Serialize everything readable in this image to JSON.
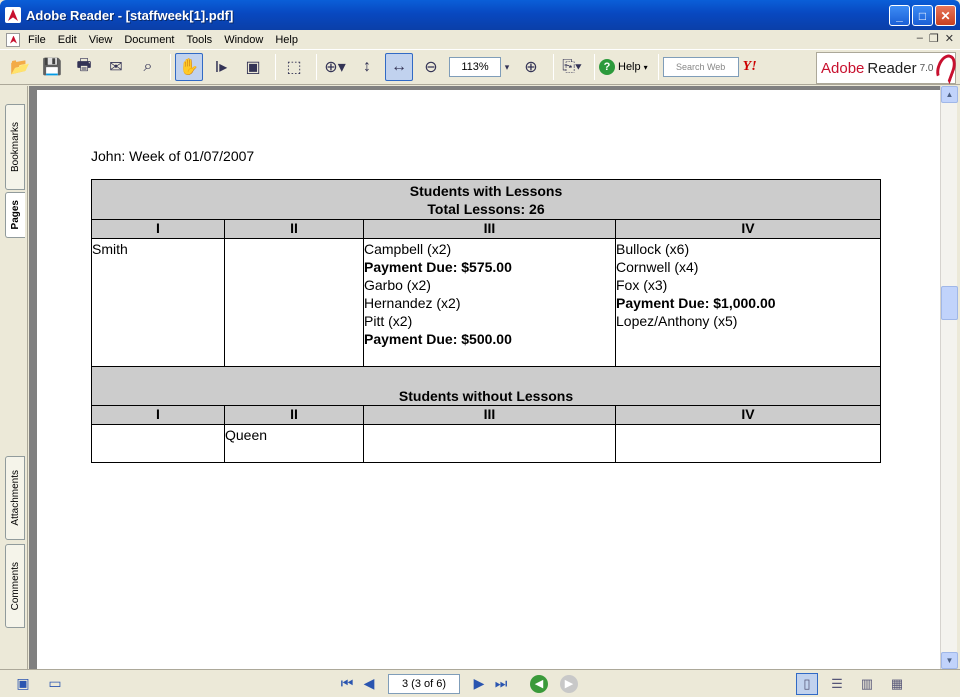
{
  "window": {
    "title": "Adobe Reader - [staffweek[1].pdf]",
    "min_icon": "_",
    "max_icon": "□",
    "close_icon": "✕"
  },
  "menu": {
    "items": [
      "File",
      "Edit",
      "View",
      "Document",
      "Tools",
      "Window",
      "Help"
    ],
    "mdi_min": "–",
    "mdi_restore": "❐",
    "mdi_close": "✕"
  },
  "toolbar": {
    "zoom_value": "113%",
    "help_label": "Help",
    "search_placeholder": "Search Web",
    "yahoo_label": "Y!",
    "brand_adobe": "Adobe",
    "brand_reader": "Reader",
    "brand_version": "7.0",
    "icons": [
      "open-icon",
      "save-icon",
      "print-icon",
      "email-icon",
      "search-icon",
      "hand-tool-icon",
      "select-text-icon",
      "snapshot-icon",
      "crop-icon",
      "zoom-in-icon",
      "fit-page-icon",
      "fit-width-icon",
      "zoom-out-minus-icon",
      "zoom-in-plus-icon",
      "rotate-icon"
    ]
  },
  "side_tabs": {
    "bookmarks": "Bookmarks",
    "pages": "Pages",
    "attachments": "Attachments",
    "comments": "Comments"
  },
  "document": {
    "heading": "John: Week of 01/07/2007",
    "with_lessons": {
      "title": "Students with Lessons",
      "total": "Total Lessons: 26",
      "columns": [
        "I",
        "II",
        "III",
        "IV"
      ],
      "col1": [
        "Smith"
      ],
      "col2": [],
      "col3": [
        {
          "text": "Campbell (x2)",
          "bold": false
        },
        {
          "text": "Payment Due: $575.00",
          "bold": true
        },
        {
          "text": "Garbo (x2)",
          "bold": false
        },
        {
          "text": "Hernandez (x2)",
          "bold": false
        },
        {
          "text": "Pitt (x2)",
          "bold": false
        },
        {
          "text": "Payment Due: $500.00",
          "bold": true
        }
      ],
      "col4": [
        {
          "text": "Bullock (x6)",
          "bold": false
        },
        {
          "text": "Cornwell (x4)",
          "bold": false
        },
        {
          "text": "Fox (x3)",
          "bold": false
        },
        {
          "text": "Payment Due: $1,000.00",
          "bold": true
        },
        {
          "text": "Lopez/Anthony (x5)",
          "bold": false
        }
      ]
    },
    "without_lessons": {
      "title": "Students without Lessons",
      "columns": [
        "I",
        "II",
        "III",
        "IV"
      ],
      "col2": [
        "Queen"
      ]
    }
  },
  "navigation": {
    "page_value": "3  (3 of 6)"
  }
}
